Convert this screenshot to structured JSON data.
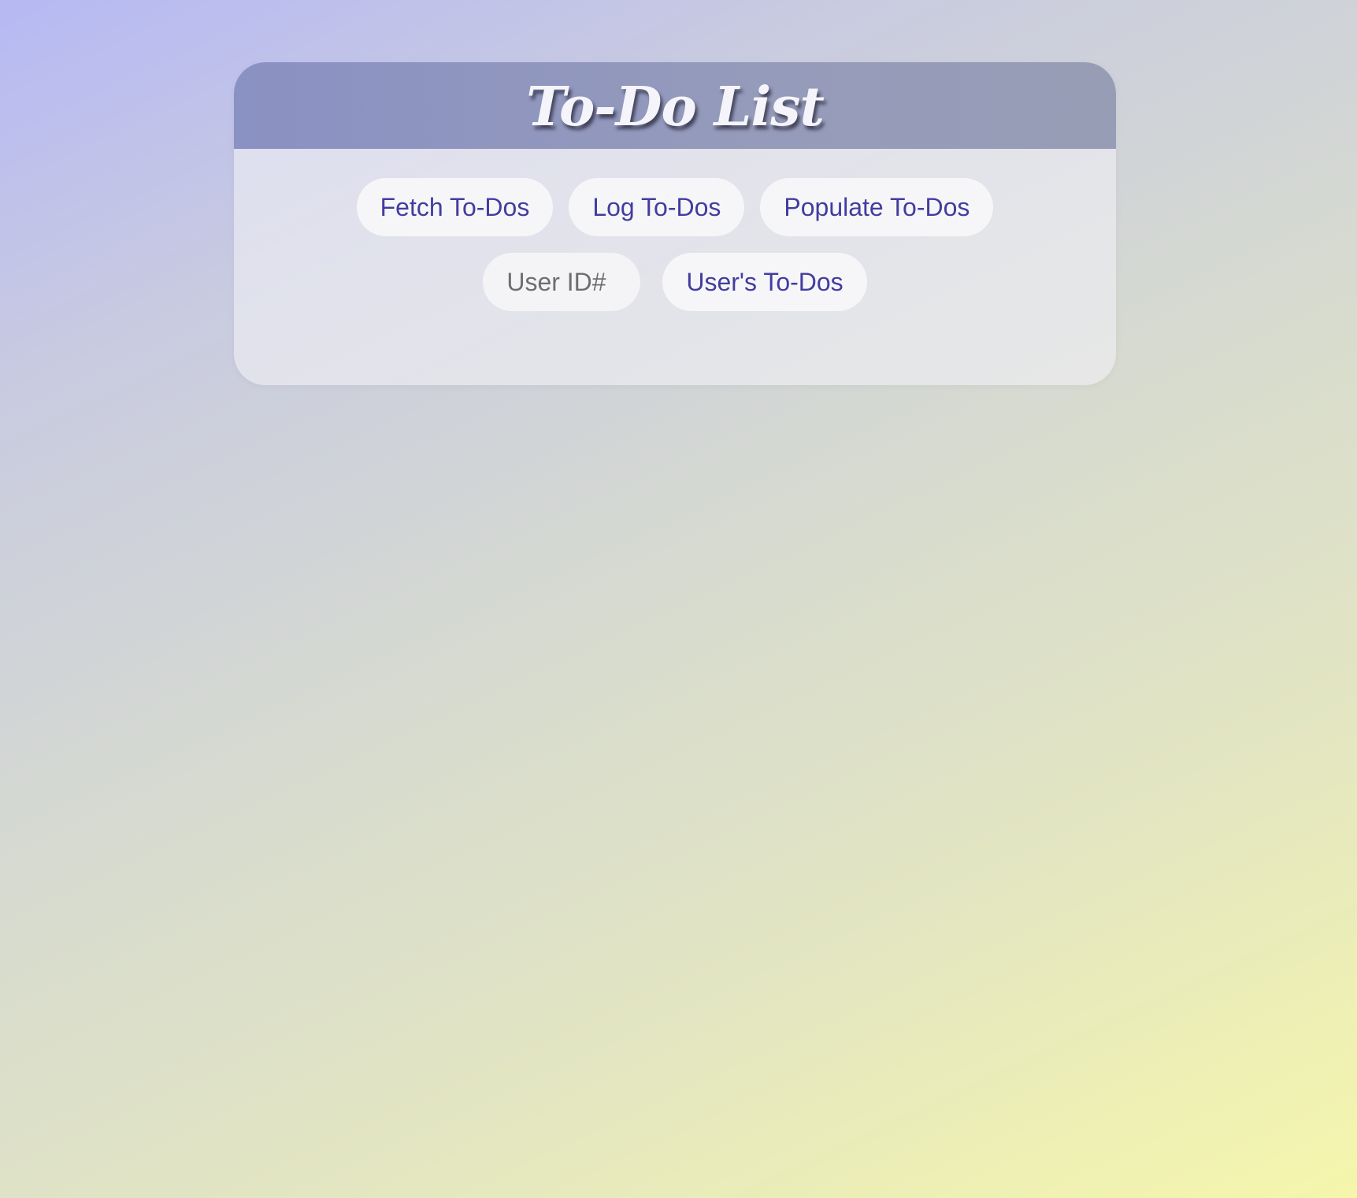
{
  "header": {
    "title": "To-Do List"
  },
  "actions": {
    "fetch_label": "Fetch To-Dos",
    "log_label": "Log To-Dos",
    "populate_label": "Populate To-Dos"
  },
  "user_query": {
    "input_placeholder": "User ID#",
    "input_value": "",
    "button_label": "User's To-Dos"
  },
  "colors": {
    "accent_text": "#423d9e",
    "header_bg": "#8f95c0",
    "gradient_start": "#b6b9f3",
    "gradient_end": "#f5f6ac"
  }
}
